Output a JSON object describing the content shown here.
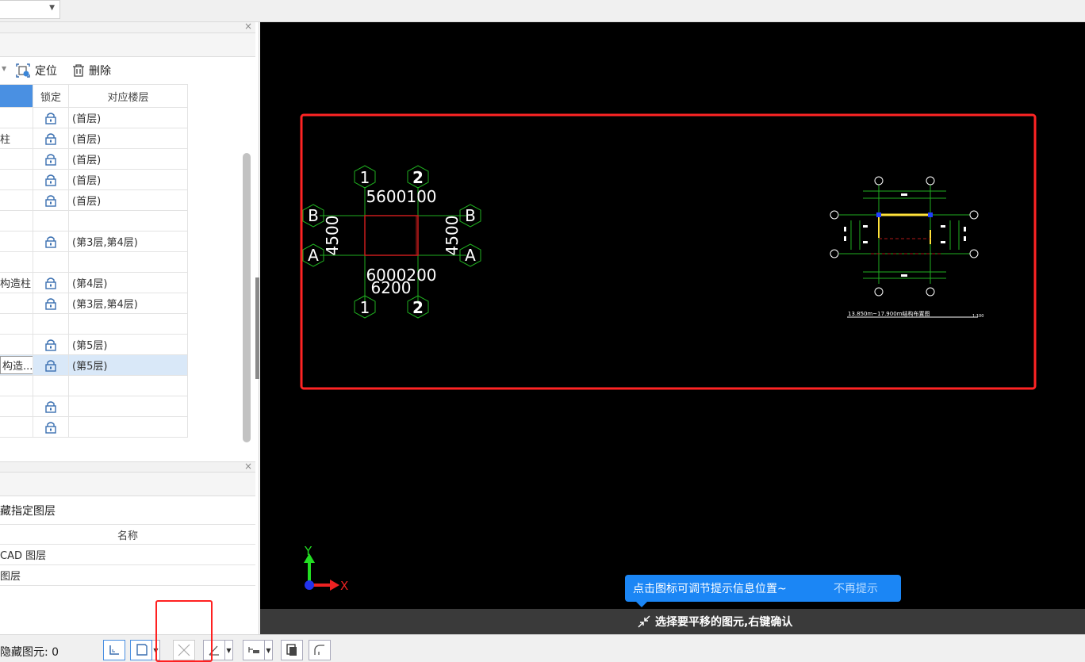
{
  "toolbar": {
    "locate_label": "定位",
    "delete_label": "删除"
  },
  "layer_table": {
    "columns": {
      "lock": "锁定",
      "floor": "对应楼层"
    },
    "rows": [
      {
        "name": "",
        "floor": "(首层)",
        "lock": true
      },
      {
        "name": "柱",
        "floor": "(首层)",
        "lock": true
      },
      {
        "name": "",
        "floor": "(首层)",
        "lock": true
      },
      {
        "name": "",
        "floor": "(首层)",
        "lock": true
      },
      {
        "name": "",
        "floor": "(首层)",
        "lock": true
      },
      {
        "name": "",
        "floor": "",
        "lock": false
      },
      {
        "name": "",
        "floor": "(第3层,第4层)",
        "lock": true
      },
      {
        "name": "",
        "floor": "",
        "lock": false
      },
      {
        "name": "构造柱",
        "floor": "(第4层)",
        "lock": true
      },
      {
        "name": "",
        "floor": "(第3层,第4层)",
        "lock": true
      },
      {
        "name": "",
        "floor": "",
        "lock": false
      },
      {
        "name": "",
        "floor": "(第5层)",
        "lock": true
      },
      {
        "name": "构造...",
        "floor": "(第5层)",
        "lock": true,
        "selected": true
      },
      {
        "name": "",
        "floor": "",
        "lock": false
      },
      {
        "name": "",
        "floor": "",
        "lock": true
      },
      {
        "name": "",
        "floor": "",
        "lock": true
      }
    ]
  },
  "layer_panel": {
    "hide_specified": "藏指定图层",
    "name_header": "名称",
    "items": [
      "CAD 图层",
      "图层"
    ]
  },
  "canvas": {
    "axis_x": "X",
    "axis_y": "Y",
    "grid_labels": {
      "col1": "1",
      "col2": "2",
      "rowA": "A",
      "rowB": "B"
    },
    "dims": {
      "top": "5600100",
      "left": "4500",
      "right": "4500",
      "bottom1": "6000200",
      "bottom2": "6200"
    },
    "drawing_caption": "13.850m~17.900m结构布置图",
    "drawing_scale": "1:100"
  },
  "tip": {
    "text": "点击图标可调节提示信息位置~",
    "dismiss": "不再提示"
  },
  "command_bar": {
    "text": "选择要平移的图元,右键确认"
  },
  "status": {
    "hidden_elements": "隐藏图元: 0"
  }
}
